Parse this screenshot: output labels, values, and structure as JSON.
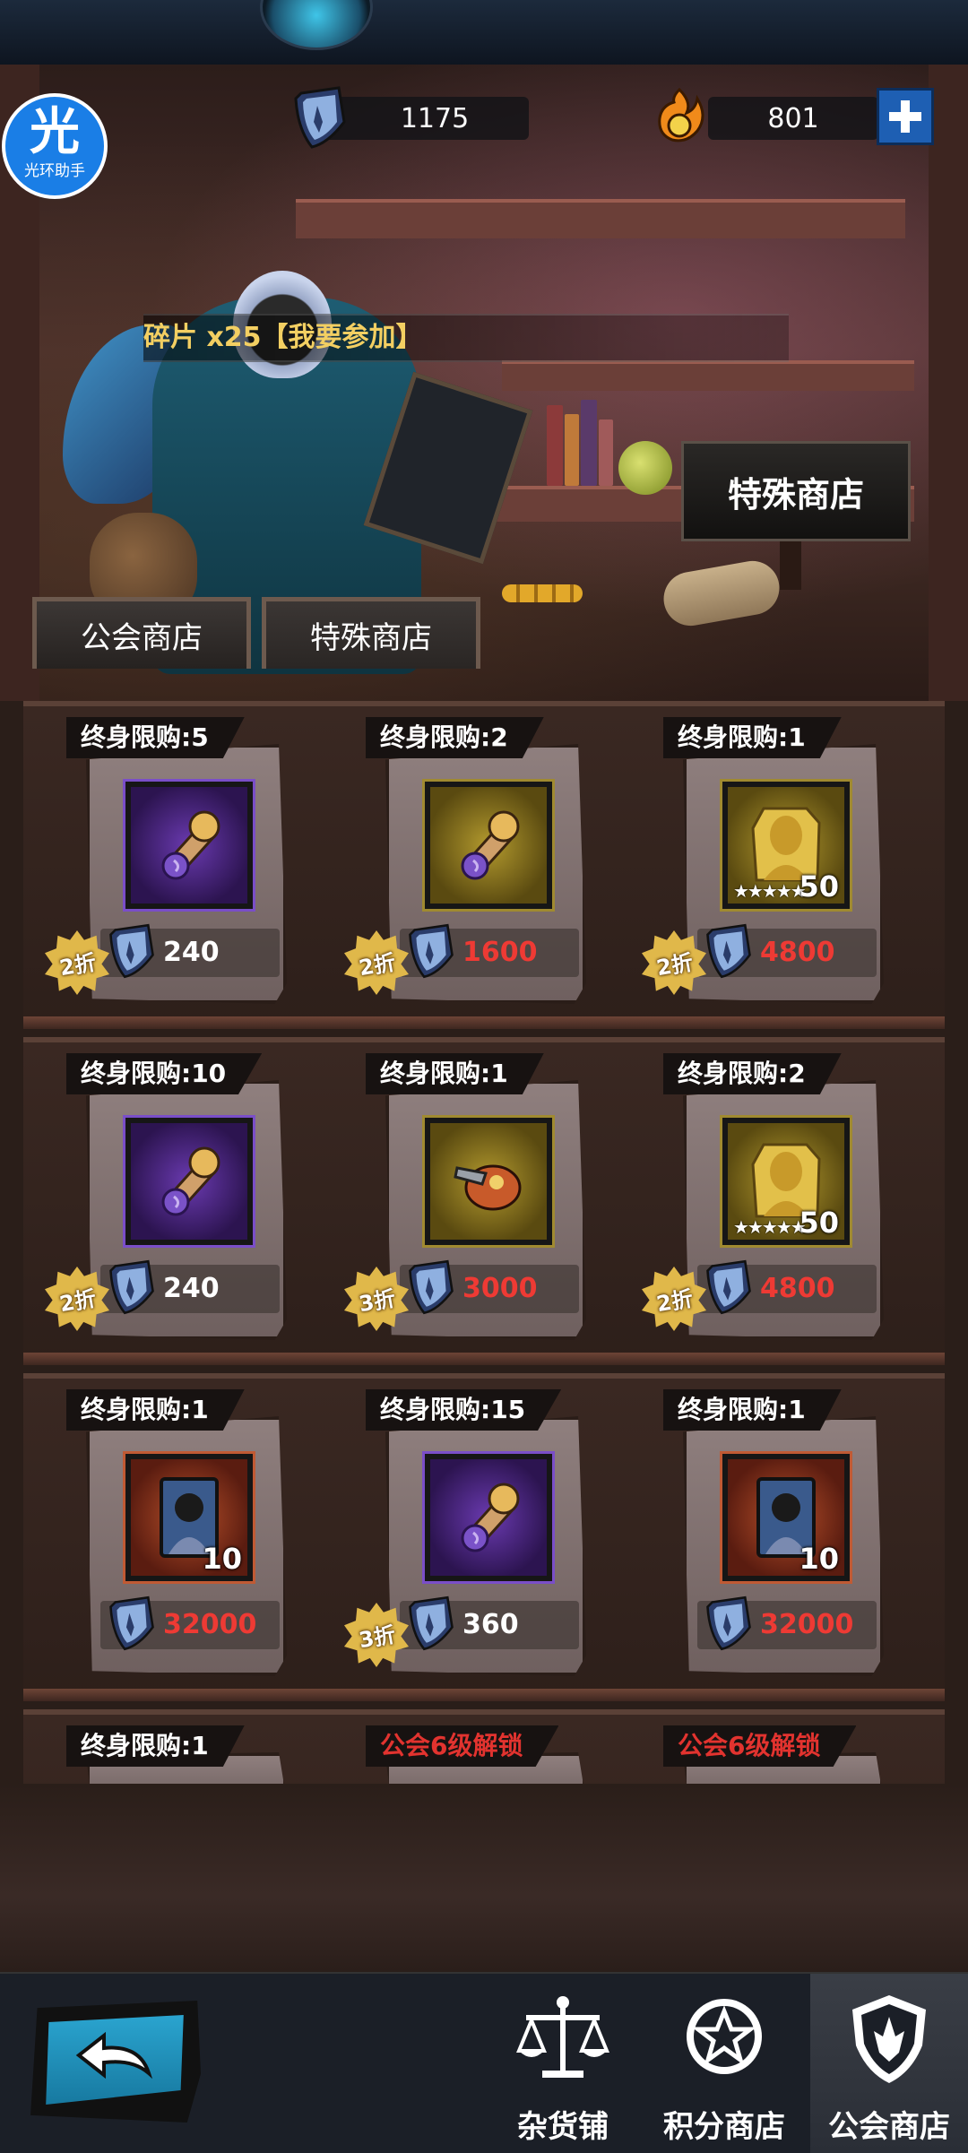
{
  "header": {
    "helper_big": "光",
    "helper_small": "光环助手",
    "shield_currency": "1175",
    "fire_currency": "801"
  },
  "ticker": "碎片 x25【我要参加】",
  "sign_label": "特殊商店",
  "tabs": [
    {
      "label": "公会商店"
    },
    {
      "label": "特殊商店"
    }
  ],
  "items": [
    {
      "limit": "终身限购:5",
      "price": "240",
      "price_color": "white",
      "discount": "2折",
      "icon": "scroll-item-icon",
      "frame": "purple"
    },
    {
      "limit": "终身限购:2",
      "price": "1600",
      "price_color": "red",
      "discount": "2折",
      "icon": "scroll-item-icon",
      "frame": "gold"
    },
    {
      "limit": "终身限购:1",
      "price": "4800",
      "price_color": "red",
      "discount": "2折",
      "icon": "hero-fragment-icon",
      "frame": "gold",
      "count": "50",
      "stars": "★★★★★"
    },
    {
      "limit": "终身限购:10",
      "price": "240",
      "price_color": "white",
      "discount": "2折",
      "icon": "scroll-item-icon",
      "frame": "purple"
    },
    {
      "limit": "终身限购:1",
      "price": "3000",
      "price_color": "red",
      "discount": "3折",
      "icon": "gauntlet-item-icon",
      "frame": "gold"
    },
    {
      "limit": "终身限购:2",
      "price": "4800",
      "price_color": "red",
      "discount": "2折",
      "icon": "hero-fragment-icon",
      "frame": "gold",
      "count": "50",
      "stars": "★★★★★"
    },
    {
      "limit": "终身限购:1",
      "price": "32000",
      "price_color": "red",
      "discount": "",
      "icon": "hero-card-icon",
      "frame": "red",
      "count": "10"
    },
    {
      "limit": "终身限购:15",
      "price": "360",
      "price_color": "white",
      "discount": "3折",
      "icon": "scroll-item-icon",
      "frame": "purple"
    },
    {
      "limit": "终身限购:1",
      "price": "32000",
      "price_color": "red",
      "discount": "",
      "icon": "hero-card-icon",
      "frame": "red",
      "count": "10"
    }
  ],
  "partial_row": [
    {
      "limit": "终身限购:1",
      "color": "white"
    },
    {
      "limit": "公会6级解锁",
      "color": "red"
    },
    {
      "limit": "公会6级解锁",
      "color": "red"
    }
  ],
  "bottom_nav": [
    {
      "label": "杂货铺",
      "icon": "scale-icon"
    },
    {
      "label": "积分商店",
      "icon": "star-badge-icon"
    },
    {
      "label": "公会商店",
      "icon": "guild-shield-icon"
    }
  ],
  "colors": {
    "price_red": "#ee3a34",
    "ticker_gold": "#f3cf62",
    "nav_bg": "#1b1f27",
    "accent_blue": "#1e5fb3"
  }
}
